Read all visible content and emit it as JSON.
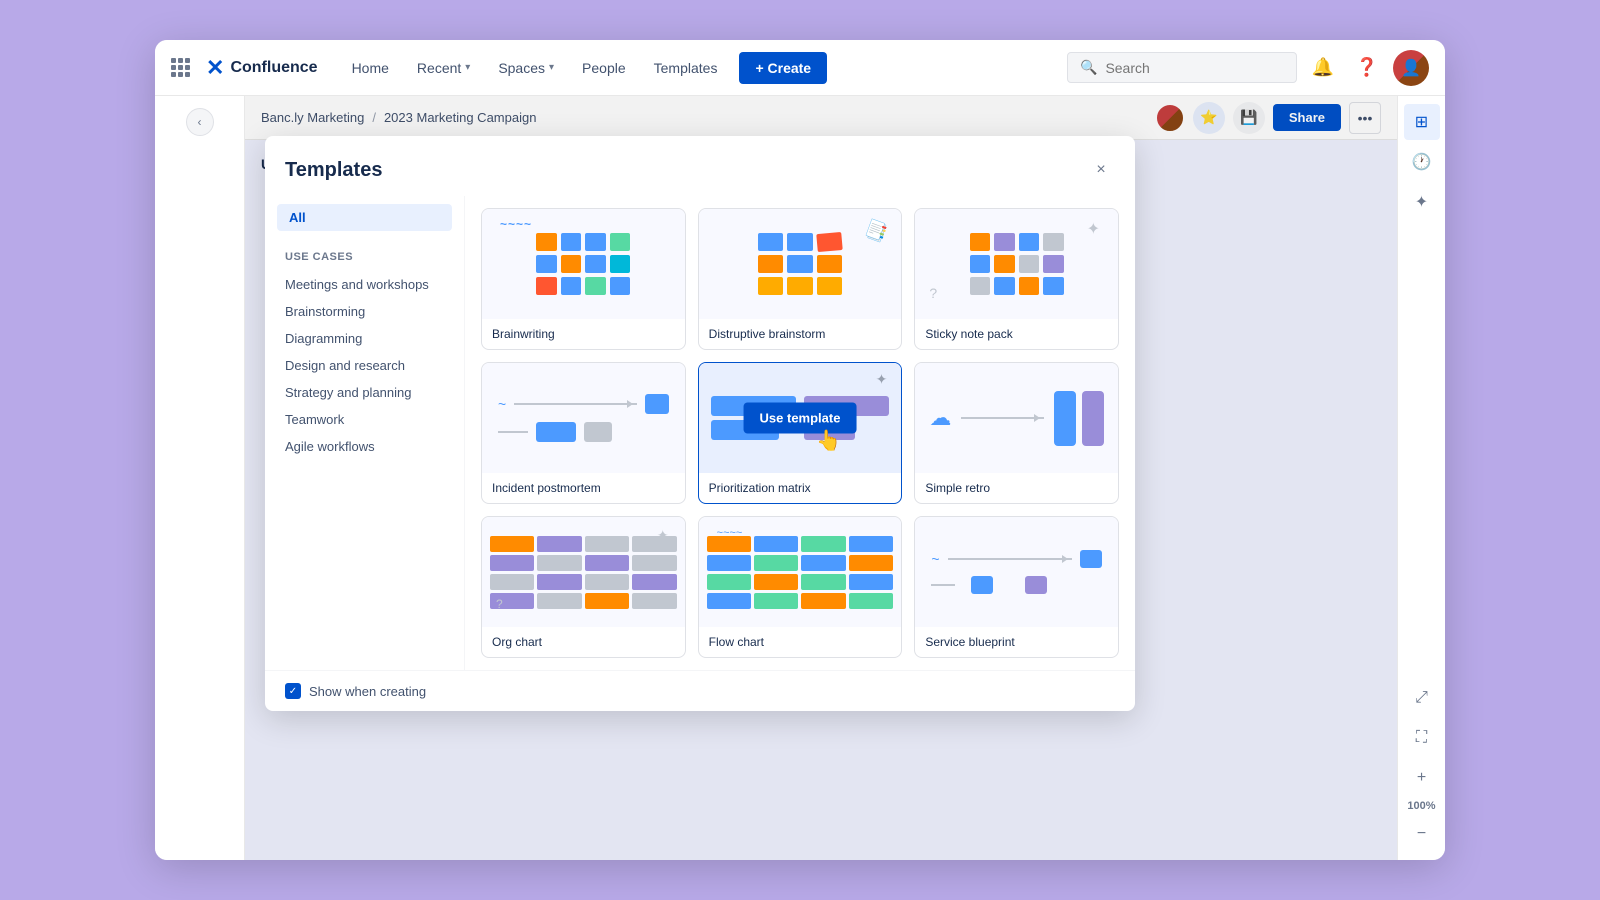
{
  "app": {
    "name": "Confluence",
    "logo_symbol": "✕"
  },
  "topnav": {
    "home": "Home",
    "recent": "Recent",
    "spaces": "Spaces",
    "people": "People",
    "templates": "Templates",
    "create": "+ Create",
    "search_placeholder": "Search"
  },
  "breadcrumb": {
    "parent1": "Banc.ly Marketing",
    "separator": "/",
    "parent2": "2023 Marketing Campaign",
    "current": "Untitled whiteboard"
  },
  "collab": {
    "share": "Share"
  },
  "templates_panel": {
    "title": "Templates",
    "close_label": "×",
    "filter_all": "All",
    "section_use_cases": "USE CASES",
    "filters": [
      "Meetings and workshops",
      "Brainstorming",
      "Diagramming",
      "Design and research",
      "Strategy and planning",
      "Teamwork",
      "Agile workflows"
    ],
    "templates": [
      {
        "id": "brainwriting",
        "label": "Brainwriting",
        "hovered": false
      },
      {
        "id": "distruptive-brainstorm",
        "label": "Distruptive brainstorm",
        "hovered": false
      },
      {
        "id": "sticky-note-pack",
        "label": "Sticky note pack",
        "hovered": false
      },
      {
        "id": "incident-postmortem",
        "label": "Incident postmortem",
        "hovered": false
      },
      {
        "id": "prioritization-matrix",
        "label": "Prioritization matrix",
        "hovered": true
      },
      {
        "id": "simple-retro",
        "label": "Simple retro",
        "hovered": false
      },
      {
        "id": "org-chart",
        "label": "Org chart",
        "hovered": false
      },
      {
        "id": "flow-chart",
        "label": "Flow chart",
        "hovered": false
      },
      {
        "id": "service-blueprint",
        "label": "Service blueprint",
        "hovered": false
      }
    ],
    "footer": {
      "checkbox_checked": true,
      "label": "Show when creating"
    },
    "use_template_btn": "Use template"
  },
  "right_panel": {
    "zoom": "100%",
    "zoom_label": "100%"
  }
}
